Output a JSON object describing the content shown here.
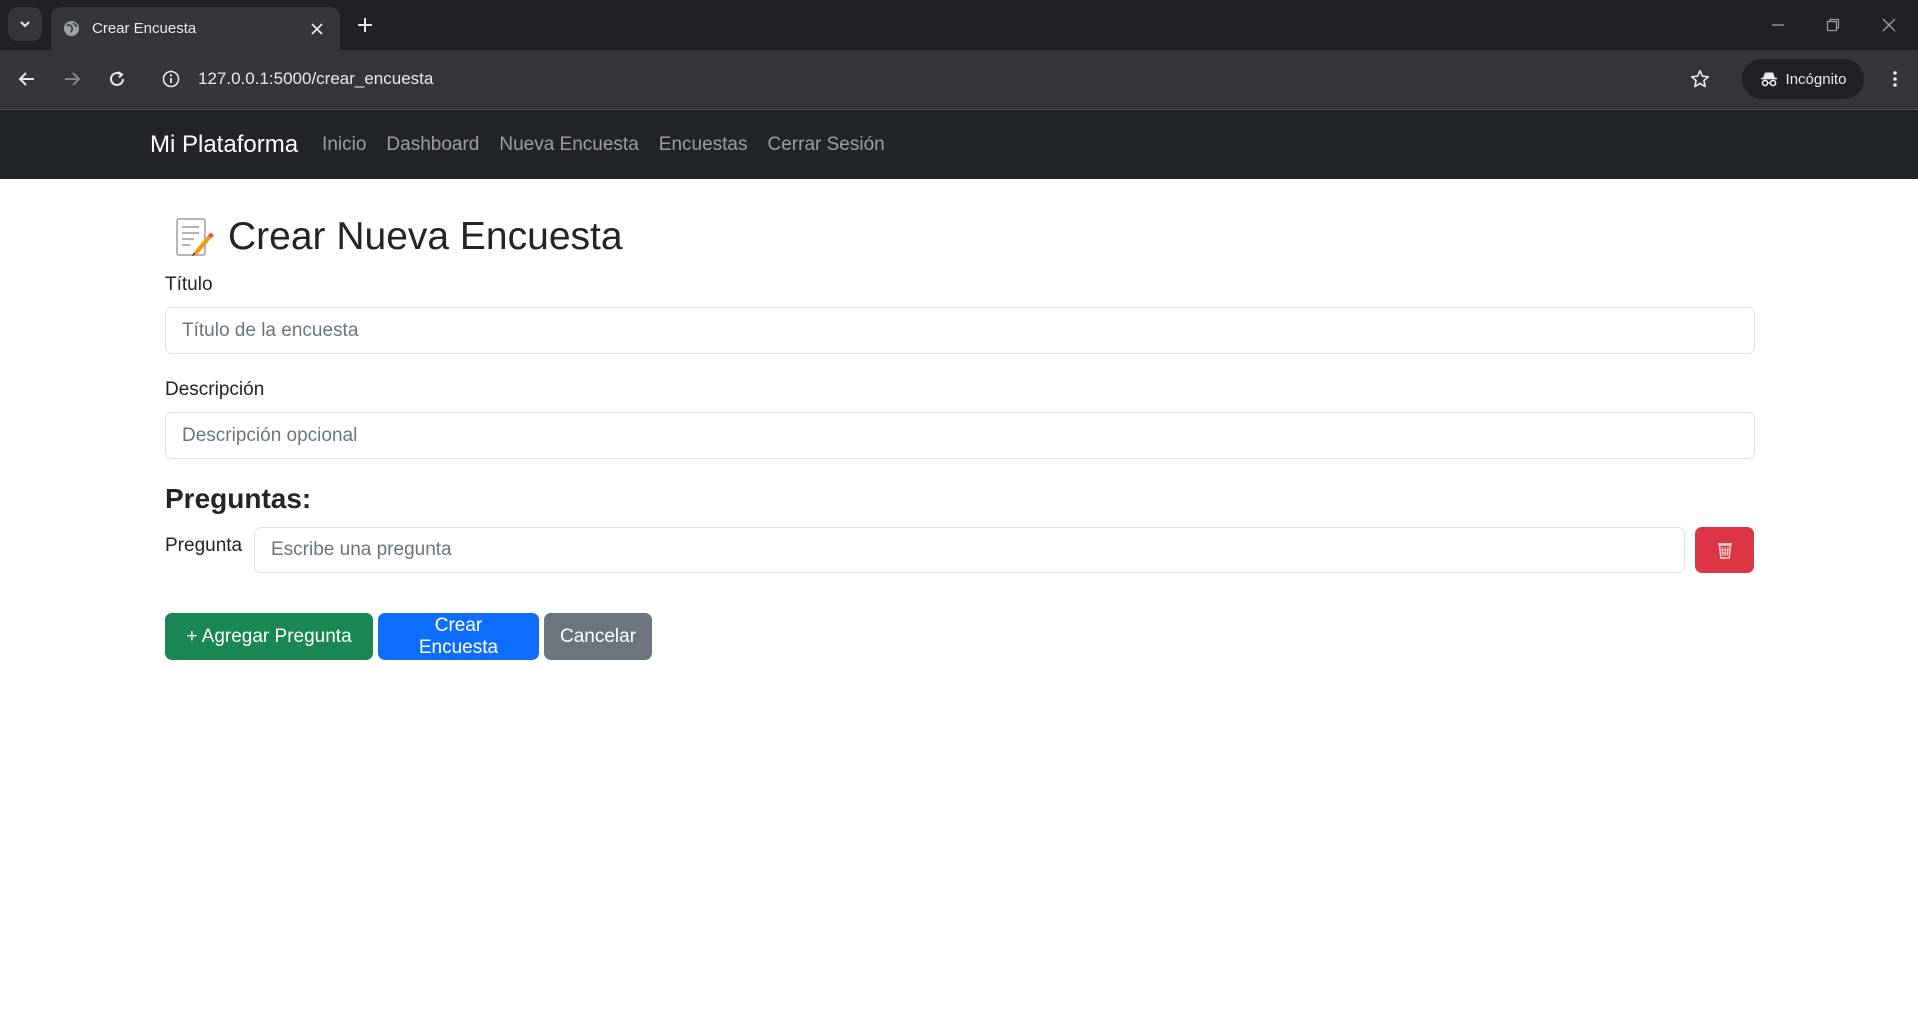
{
  "browser": {
    "tab_title": "Crear Encuesta",
    "url": "127.0.0.1:5000/crear_encuesta",
    "incognito_label": "Incógnito"
  },
  "navbar": {
    "brand": "Mi Plataforma",
    "links": [
      "Inicio",
      "Dashboard",
      "Nueva Encuesta",
      "Encuestas",
      "Cerrar Sesión"
    ]
  },
  "form": {
    "heading": "Crear Nueva Encuesta",
    "title_label": "Título",
    "title_placeholder": "Título de la encuesta",
    "title_value": "",
    "description_label": "Descripción",
    "description_placeholder": "Descripción opcional",
    "description_value": "",
    "questions_heading": "Preguntas:",
    "question_label": "Pregunta",
    "question_placeholder": "Escribe una pregunta",
    "question_value": ""
  },
  "buttons": {
    "add_question": "+ Agregar Pregunta",
    "create_survey": "Crear Encuesta",
    "cancel": "Cancelar"
  },
  "colors": {
    "navbar_bg": "#212529",
    "success": "#198754",
    "primary": "#0d6efd",
    "secondary": "#6c757d",
    "danger": "#dc3545"
  },
  "icons": {
    "title_icon": "memo-icon",
    "delete_icon": "trash-icon"
  }
}
